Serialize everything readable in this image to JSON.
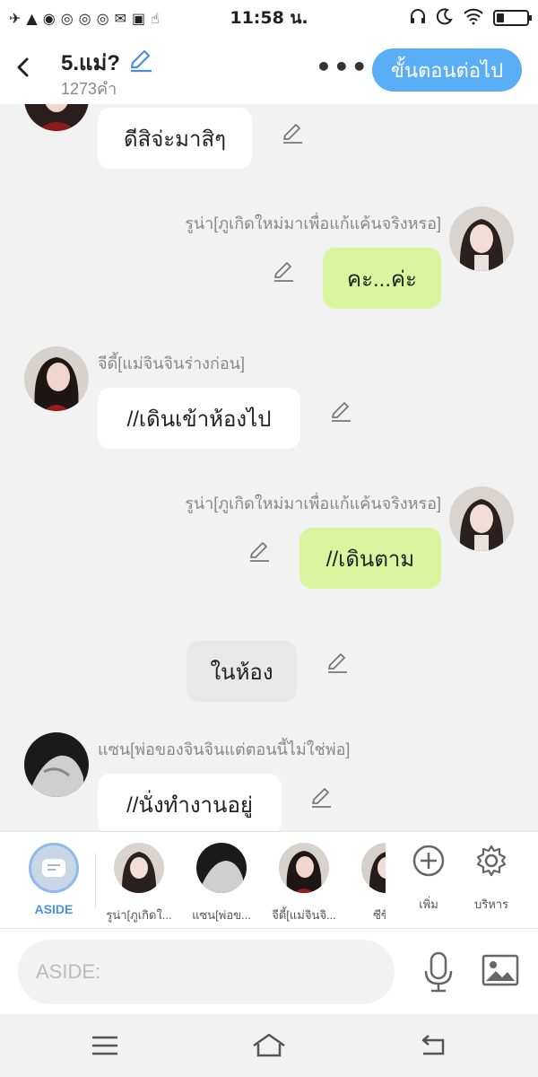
{
  "status_bar": {
    "time": "11:58 น.",
    "left_icons": [
      "airplane-icon",
      "warning-icon",
      "messenger-icon",
      "chrome-icon",
      "chrome-icon",
      "chrome-icon",
      "mail-icon",
      "voicemail-icon",
      "gesture-icon"
    ],
    "right_icons": [
      "headphones-icon",
      "moon-icon",
      "wifi-icon",
      "battery-icon"
    ]
  },
  "header": {
    "title": "5.แม่?",
    "word_count": "1273คำ",
    "next_label": "ขั้นตอนต่อไป",
    "accent_color": "#5aaef5"
  },
  "messages": [
    {
      "side": "left",
      "speaker": "",
      "text": "ดีสิจ่ะมาสิๆ",
      "avatar": "gidi-avatar"
    },
    {
      "side": "right",
      "speaker": "รูน่า[ภูเกิดใหม่มาเพื่อแก้แค้นจริงหรอ]",
      "text": "คะ...ค่ะ",
      "avatar": "runa-avatar"
    },
    {
      "side": "left",
      "speaker": "จีดี้[แม่จินจินร่างก่อน]",
      "text": "//เดินเข้าห้องไป",
      "avatar": "gidi-avatar"
    },
    {
      "side": "right",
      "speaker": "รูน่า[ภูเกิดใหม่มาเพื่อแก้แค้นจริงหรอ]",
      "text": "//เดินตาม",
      "avatar": "runa-avatar"
    },
    {
      "side": "narration",
      "speaker": "",
      "text": "ในห้อง",
      "avatar": ""
    },
    {
      "side": "left",
      "speaker": "แซน[พ่อของจินจินแต่ตอนนี้ไม่ใช่พ่อ]",
      "text": "//นั่งทำงานอยู่",
      "avatar": "zen-avatar"
    }
  ],
  "character_bar": {
    "aside_label": "ASIDE",
    "characters": [
      {
        "label": "รูน่า[ภูเกิดใ..."
      },
      {
        "label": "แซน[พ่อข..."
      },
      {
        "label": "จีดี้[แม่จินจิ..."
      },
      {
        "label": "ซีซี้[แ"
      }
    ],
    "add_label": "เพิ่ม",
    "manage_label": "บริหาร"
  },
  "input": {
    "placeholder": "ASIDE:"
  },
  "colors": {
    "right_bubble": "#d9f59e",
    "left_bubble": "#ffffff",
    "narration_bubble": "#e8e8e8",
    "background": "#f2f2f2"
  }
}
